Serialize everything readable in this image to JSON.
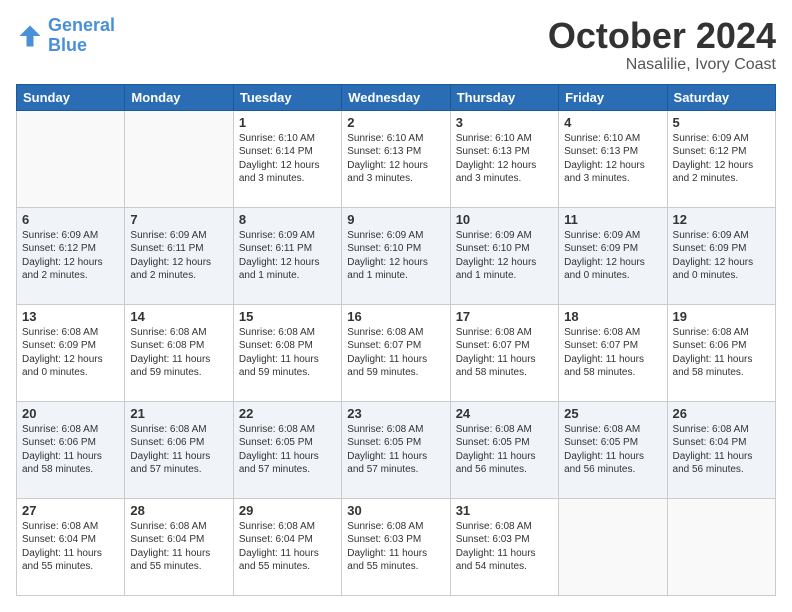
{
  "header": {
    "logo_line1": "General",
    "logo_line2": "Blue",
    "title": "October 2024",
    "subtitle": "Nasalilie, Ivory Coast"
  },
  "weekdays": [
    "Sunday",
    "Monday",
    "Tuesday",
    "Wednesday",
    "Thursday",
    "Friday",
    "Saturday"
  ],
  "weeks": [
    [
      {
        "day": "",
        "info": ""
      },
      {
        "day": "",
        "info": ""
      },
      {
        "day": "1",
        "info": "Sunrise: 6:10 AM\nSunset: 6:14 PM\nDaylight: 12 hours and 3 minutes."
      },
      {
        "day": "2",
        "info": "Sunrise: 6:10 AM\nSunset: 6:13 PM\nDaylight: 12 hours and 3 minutes."
      },
      {
        "day": "3",
        "info": "Sunrise: 6:10 AM\nSunset: 6:13 PM\nDaylight: 12 hours and 3 minutes."
      },
      {
        "day": "4",
        "info": "Sunrise: 6:10 AM\nSunset: 6:13 PM\nDaylight: 12 hours and 3 minutes."
      },
      {
        "day": "5",
        "info": "Sunrise: 6:09 AM\nSunset: 6:12 PM\nDaylight: 12 hours and 2 minutes."
      }
    ],
    [
      {
        "day": "6",
        "info": "Sunrise: 6:09 AM\nSunset: 6:12 PM\nDaylight: 12 hours and 2 minutes."
      },
      {
        "day": "7",
        "info": "Sunrise: 6:09 AM\nSunset: 6:11 PM\nDaylight: 12 hours and 2 minutes."
      },
      {
        "day": "8",
        "info": "Sunrise: 6:09 AM\nSunset: 6:11 PM\nDaylight: 12 hours and 1 minute."
      },
      {
        "day": "9",
        "info": "Sunrise: 6:09 AM\nSunset: 6:10 PM\nDaylight: 12 hours and 1 minute."
      },
      {
        "day": "10",
        "info": "Sunrise: 6:09 AM\nSunset: 6:10 PM\nDaylight: 12 hours and 1 minute."
      },
      {
        "day": "11",
        "info": "Sunrise: 6:09 AM\nSunset: 6:09 PM\nDaylight: 12 hours and 0 minutes."
      },
      {
        "day": "12",
        "info": "Sunrise: 6:09 AM\nSunset: 6:09 PM\nDaylight: 12 hours and 0 minutes."
      }
    ],
    [
      {
        "day": "13",
        "info": "Sunrise: 6:08 AM\nSunset: 6:09 PM\nDaylight: 12 hours and 0 minutes."
      },
      {
        "day": "14",
        "info": "Sunrise: 6:08 AM\nSunset: 6:08 PM\nDaylight: 11 hours and 59 minutes."
      },
      {
        "day": "15",
        "info": "Sunrise: 6:08 AM\nSunset: 6:08 PM\nDaylight: 11 hours and 59 minutes."
      },
      {
        "day": "16",
        "info": "Sunrise: 6:08 AM\nSunset: 6:07 PM\nDaylight: 11 hours and 59 minutes."
      },
      {
        "day": "17",
        "info": "Sunrise: 6:08 AM\nSunset: 6:07 PM\nDaylight: 11 hours and 58 minutes."
      },
      {
        "day": "18",
        "info": "Sunrise: 6:08 AM\nSunset: 6:07 PM\nDaylight: 11 hours and 58 minutes."
      },
      {
        "day": "19",
        "info": "Sunrise: 6:08 AM\nSunset: 6:06 PM\nDaylight: 11 hours and 58 minutes."
      }
    ],
    [
      {
        "day": "20",
        "info": "Sunrise: 6:08 AM\nSunset: 6:06 PM\nDaylight: 11 hours and 58 minutes."
      },
      {
        "day": "21",
        "info": "Sunrise: 6:08 AM\nSunset: 6:06 PM\nDaylight: 11 hours and 57 minutes."
      },
      {
        "day": "22",
        "info": "Sunrise: 6:08 AM\nSunset: 6:05 PM\nDaylight: 11 hours and 57 minutes."
      },
      {
        "day": "23",
        "info": "Sunrise: 6:08 AM\nSunset: 6:05 PM\nDaylight: 11 hours and 57 minutes."
      },
      {
        "day": "24",
        "info": "Sunrise: 6:08 AM\nSunset: 6:05 PM\nDaylight: 11 hours and 56 minutes."
      },
      {
        "day": "25",
        "info": "Sunrise: 6:08 AM\nSunset: 6:05 PM\nDaylight: 11 hours and 56 minutes."
      },
      {
        "day": "26",
        "info": "Sunrise: 6:08 AM\nSunset: 6:04 PM\nDaylight: 11 hours and 56 minutes."
      }
    ],
    [
      {
        "day": "27",
        "info": "Sunrise: 6:08 AM\nSunset: 6:04 PM\nDaylight: 11 hours and 55 minutes."
      },
      {
        "day": "28",
        "info": "Sunrise: 6:08 AM\nSunset: 6:04 PM\nDaylight: 11 hours and 55 minutes."
      },
      {
        "day": "29",
        "info": "Sunrise: 6:08 AM\nSunset: 6:04 PM\nDaylight: 11 hours and 55 minutes."
      },
      {
        "day": "30",
        "info": "Sunrise: 6:08 AM\nSunset: 6:03 PM\nDaylight: 11 hours and 55 minutes."
      },
      {
        "day": "31",
        "info": "Sunrise: 6:08 AM\nSunset: 6:03 PM\nDaylight: 11 hours and 54 minutes."
      },
      {
        "day": "",
        "info": ""
      },
      {
        "day": "",
        "info": ""
      }
    ]
  ]
}
